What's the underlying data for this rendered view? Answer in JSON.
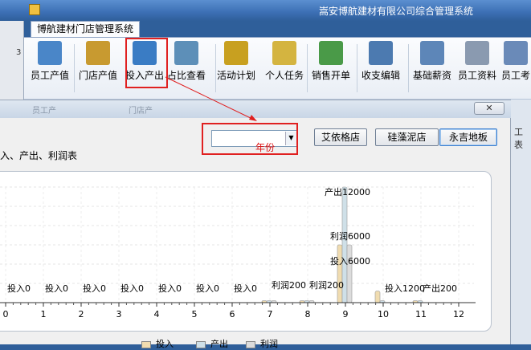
{
  "window": {
    "title": "嵩安博航建材有限公司综合管理系统"
  },
  "tab": {
    "label": "博航建材门店管理系统"
  },
  "left_strip_text": "3",
  "toolbar": [
    {
      "label": "员工产值",
      "color": "#4a86c8"
    },
    {
      "label": "门店产值",
      "color": "#c89a30"
    },
    {
      "label": "投入产出",
      "color": "#3a7cc4"
    },
    {
      "label": "占比查看",
      "color": "#5d8fb8"
    },
    {
      "label": "活动计划",
      "color": "#c8a020"
    },
    {
      "label": "个人任务",
      "color": "#d4b440"
    },
    {
      "label": "销售开单",
      "color": "#4a9a48"
    },
    {
      "label": "收支编辑",
      "color": "#4c7ab0"
    },
    {
      "label": "基础薪资",
      "color": "#5d86b8"
    },
    {
      "label": "员工资料",
      "color": "#8a9ab0"
    },
    {
      "label": "员工考",
      "color": "#6a8ab8"
    }
  ],
  "dialog": {
    "ghost_tabs": [
      "员工产",
      "门店产"
    ],
    "close": "✕",
    "right_panel_text": "工表"
  },
  "filter": {
    "year_value": "",
    "year_annotation": "年份",
    "stores": [
      "艾依格店",
      "硅藻泥店",
      "永吉地板"
    ],
    "selected_store": "永吉地板"
  },
  "chart_title": "入、产出、利润表",
  "chart_data": {
    "type": "bar",
    "x": [
      0,
      1,
      2,
      3,
      4,
      5,
      6,
      7,
      8,
      9,
      10,
      11,
      12
    ],
    "series": [
      {
        "name": "投入",
        "color": "#f0dcb0",
        "values": [
          0,
          0,
          0,
          0,
          0,
          0,
          0,
          200,
          200,
          6000,
          1200,
          200,
          0
        ]
      },
      {
        "name": "产出",
        "color": "#cfe0e8",
        "values": [
          0,
          0,
          0,
          0,
          0,
          0,
          0,
          200,
          200,
          12000,
          200,
          200,
          0
        ]
      },
      {
        "name": "利润",
        "color": "#dcdcdc",
        "values": [
          0,
          0,
          0,
          0,
          0,
          0,
          0,
          200,
          200,
          6000,
          0,
          0,
          0
        ]
      }
    ],
    "ylim": [
      0,
      12000
    ],
    "grid": true,
    "legend": "bottom",
    "data_labels": [
      {
        "x": 0,
        "text": "投入0"
      },
      {
        "x": 1,
        "text": "投入0"
      },
      {
        "x": 2,
        "text": "投入0"
      },
      {
        "x": 3,
        "text": "投入0"
      },
      {
        "x": 4,
        "text": "投入0"
      },
      {
        "x": 5,
        "text": "投入0"
      },
      {
        "x": 6,
        "text": "投入0"
      },
      {
        "x": 7,
        "text": "利润200"
      },
      {
        "x": 8,
        "text": "利润200"
      },
      {
        "x": 9,
        "text": "产出12000"
      },
      {
        "x": 9,
        "text": "利润6000"
      },
      {
        "x": 9,
        "text": "投入6000"
      },
      {
        "x": 10,
        "text": "投入1200"
      },
      {
        "x": 11,
        "text": "产出200"
      }
    ]
  }
}
